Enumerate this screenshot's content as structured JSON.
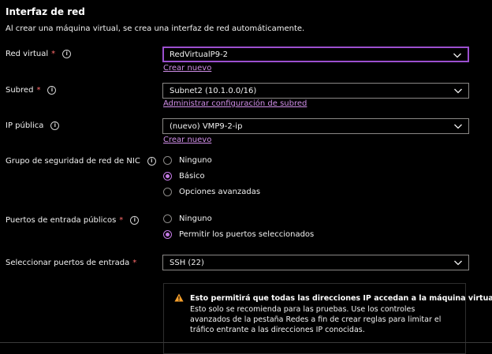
{
  "section": {
    "title": "Interfaz de red",
    "subtitle": "Al crear una máquina virtual, se crea una interfaz de red automáticamente."
  },
  "fields": {
    "vnet": {
      "label": "Red virtual",
      "required": "*",
      "value": "RedVirtualP9-2",
      "link": "Crear nuevo"
    },
    "subnet": {
      "label": "Subred",
      "required": "*",
      "value": "Subnet2 (10.1.0.0/16)",
      "link": "Administrar configuración de subred"
    },
    "public_ip": {
      "label": "IP pública",
      "value": "(nuevo) VMP9-2-ip",
      "link": "Crear nuevo"
    },
    "nsg": {
      "label": "Grupo de seguridad de red de NIC",
      "options": [
        "Ninguno",
        "Básico",
        "Opciones avanzadas"
      ],
      "selected": "Básico"
    },
    "inbound_ports": {
      "label": "Puertos de entrada públicos",
      "required": "*",
      "options": [
        "Ninguno",
        "Permitir los puertos seleccionados"
      ],
      "selected": "Permitir los puertos seleccionados"
    },
    "select_ports": {
      "label": "Seleccionar puertos de entrada",
      "required": "*",
      "value": "SSH (22)"
    }
  },
  "warning": {
    "title": "Esto permitirá que todas las direcciones IP accedan a la máquina virtual.",
    "body": "Esto solo se recomienda para las pruebas.  Use los controles avanzados de la pestaña Redes a fin de crear reglas para limitar el tráfico entrante a las direcciones IP conocidas."
  },
  "icons": {
    "info": "info-icon",
    "chevron": "chevron-down-icon",
    "warning": "warning-icon"
  },
  "colors": {
    "accent": "#c57ae6",
    "link": "#d08ee8",
    "focus_border": "#9b4fcf",
    "required": "#ff6b6b",
    "warning": "#f7a02c"
  }
}
